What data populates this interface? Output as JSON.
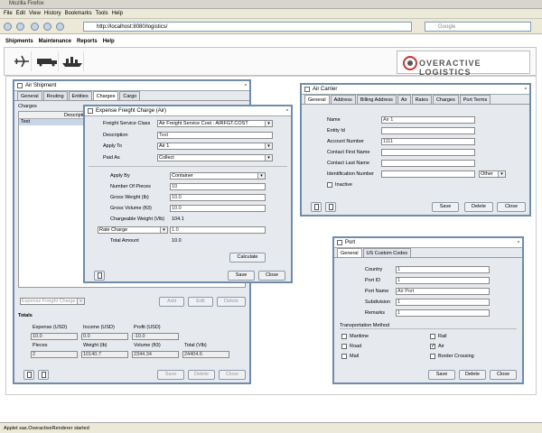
{
  "browser": {
    "title": "Mozilla Firefox",
    "menu": [
      "File",
      "Edit",
      "View",
      "History",
      "Bookmarks",
      "Tools",
      "Help"
    ],
    "url": "http://localhost:8080/logistics/",
    "search_placeholder": "Google",
    "status": "Applet sas.OveractiveRenderer started"
  },
  "app": {
    "menu": [
      "Shipments",
      "Maintenance",
      "Reports",
      "Help"
    ],
    "logo": "OVERACTIVE LOGISTICS",
    "icons": [
      "airplane-icon",
      "truck-icon",
      "ship-icon"
    ]
  },
  "air_shipment": {
    "title": "Air Shipment",
    "tabs": [
      "General",
      "Routing",
      "Entities",
      "Charges",
      "Cargo"
    ],
    "active_tab": "Charges",
    "section": "Charges",
    "col": "Descriptio",
    "row": "Test",
    "dropdown": "Expense Freight Charge",
    "buttons": {
      "add": "Add",
      "edit": "Edit",
      "delete": "Delete",
      "save": "Save",
      "del2": "Delete",
      "close": "Close"
    },
    "totals_title": "Totals",
    "totals": {
      "h1": [
        "Expense (USD)",
        "Income (USD)",
        "Profit (USD)"
      ],
      "v1": [
        "10.0",
        "0.0",
        "-10.0"
      ],
      "h2": [
        "Pieces",
        "Weight (lb)",
        "Volume (ft3)",
        "Total (Vlb)"
      ],
      "v2": [
        "2",
        "10140.7",
        "2344.34",
        "24404.6"
      ]
    }
  },
  "freight_charge": {
    "title": "Expense Freight Charge (Air)",
    "labels": [
      "Freight Service Class",
      "Description",
      "Apply To",
      "Paid As"
    ],
    "values": [
      "Air Freight Service Cost : AIRFGT.COST",
      "Test",
      "Air 1",
      "Collect"
    ],
    "labels2": [
      "Apply By",
      "Number Of Pieces",
      "Gross Weight (lb)",
      "Gross Volume (ft3)",
      "Chargeable Weight (Vlb)",
      "Rate Charge",
      "Total Amount"
    ],
    "values2": [
      "Container",
      "10",
      "10.0",
      "10.0",
      "104.1",
      "1.0",
      "10.0"
    ],
    "calc": "Calculate",
    "save": "Save",
    "close": "Close"
  },
  "air_carrier": {
    "title": "Air Carrier",
    "tabs": [
      "General",
      "Address",
      "Billing Address",
      "Air",
      "Rates",
      "Charges",
      "Port Terms"
    ],
    "active_tab": "General",
    "labels": [
      "Name",
      "Entity Id",
      "Account Number",
      "Contact First Name",
      "Contact Last Name",
      "Identification Number"
    ],
    "values": [
      "Air 1",
      "",
      "1111",
      "",
      "",
      ""
    ],
    "other": "Other",
    "inactive": "Inactive",
    "save": "Save",
    "delete": "Delete",
    "close": "Close"
  },
  "port": {
    "title": "Port",
    "tabs": [
      "General",
      "US Custom Codes"
    ],
    "active_tab": "General",
    "labels": [
      "Country",
      "Port ID",
      "Port Name",
      "Subdivision",
      "Remarks"
    ],
    "values": [
      "1",
      "1",
      "Air Port",
      "1",
      "1"
    ],
    "method_title": "Transportation Method",
    "methods": [
      "Maritime",
      "Rail",
      "Road",
      "Air",
      "Mail",
      "Border Crossing"
    ],
    "checked": [
      false,
      false,
      false,
      true,
      false,
      false
    ],
    "save": "Save",
    "delete": "Delete",
    "close": "Close"
  }
}
